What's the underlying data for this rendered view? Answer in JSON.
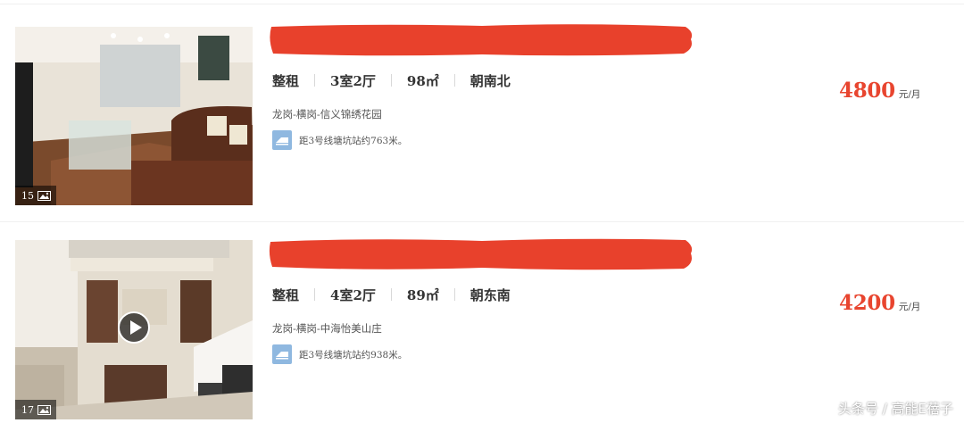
{
  "listings": [
    {
      "photo_count": "15",
      "rent_type": "整租",
      "layout": "3室2厅",
      "size": "98㎡",
      "orientation": "朝南北",
      "area": "龙岗-横岗-信义锦绣花园",
      "subway": "距3号线塘坑站约763米。",
      "price": "4800",
      "price_unit": "元/月",
      "title_redacted": true
    },
    {
      "photo_count": "17",
      "rent_type": "整租",
      "layout": "4室2厅",
      "size": "89㎡",
      "orientation": "朝东南",
      "area": "龙岗-横岗-中海怡美山庄",
      "subway": "距3号线塘坑站约938米。",
      "price": "4200",
      "price_unit": "元/月",
      "title_redacted": true,
      "has_video": true
    }
  ],
  "watermark": "头条号 / 高能E蓓子",
  "colors": {
    "price": "#e8452f",
    "redaction": "#e8412c",
    "subway_icon": "#8fb8e0"
  },
  "icons": {
    "photo_count": "image-icon",
    "subway": "subway-icon",
    "video": "play-icon"
  }
}
